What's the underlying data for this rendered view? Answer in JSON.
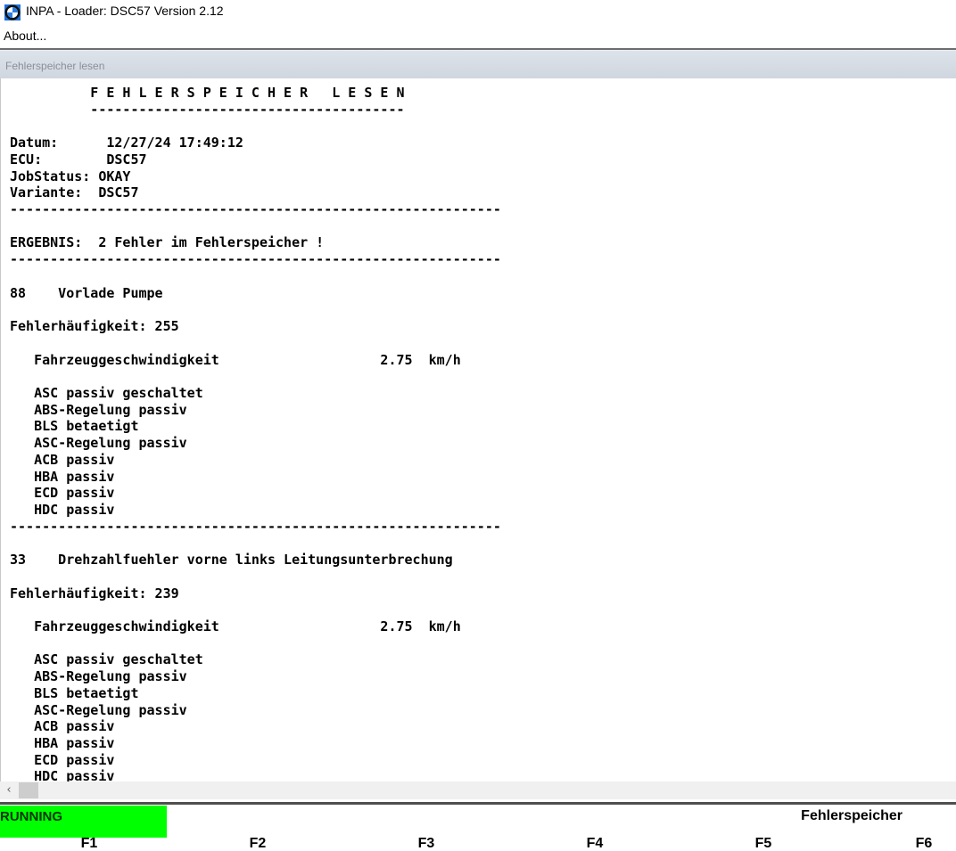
{
  "window": {
    "title": "INPA - Loader:  DSC57 Version 2.12",
    "icon": "bmw-roundel-icon"
  },
  "menu": {
    "about_label": "About..."
  },
  "subwindow": {
    "title": "Fehlerspeicher lesen"
  },
  "report": {
    "lines": [
      "          F E H L E R S P E I C H E R   L E S E N",
      "          ---------------------------------------",
      "",
      "Datum:      12/27/24 17:49:12",
      "ECU:        DSC57",
      "JobStatus: OKAY",
      "Variante:  DSC57",
      "-------------------------------------------------------------",
      "",
      "ERGEBNIS:  2 Fehler im Fehlerspeicher !",
      "-------------------------------------------------------------",
      "",
      "88    Vorlade Pumpe",
      "",
      "Fehlerhäufigkeit: 255",
      "",
      "   Fahrzeuggeschwindigkeit                    2.75  km/h",
      "",
      "   ASC passiv geschaltet",
      "   ABS-Regelung passiv",
      "   BLS betaetigt",
      "   ASC-Regelung passiv",
      "   ACB passiv",
      "   HBA passiv",
      "   ECD passiv",
      "   HDC passiv",
      "-------------------------------------------------------------",
      "",
      "33    Drehzahlfuehler vorne links Leitungsunterbrechung",
      "",
      "Fehlerhäufigkeit: 239",
      "",
      "   Fahrzeuggeschwindigkeit                    2.75  km/h",
      "",
      "   ASC passiv geschaltet",
      "   ABS-Regelung passiv",
      "   BLS betaetigt",
      "   ASC-Regelung passiv",
      "   ACB passiv",
      "   HBA passiv",
      "   ECD passiv",
      "   HDC passiv"
    ]
  },
  "status": {
    "running_text": "RUNNING",
    "running_color": "#00ff00",
    "section_label": "Fehlerspeicher"
  },
  "fkeys": [
    "F1",
    "F2",
    "F3",
    "F4",
    "F5",
    "F6"
  ]
}
